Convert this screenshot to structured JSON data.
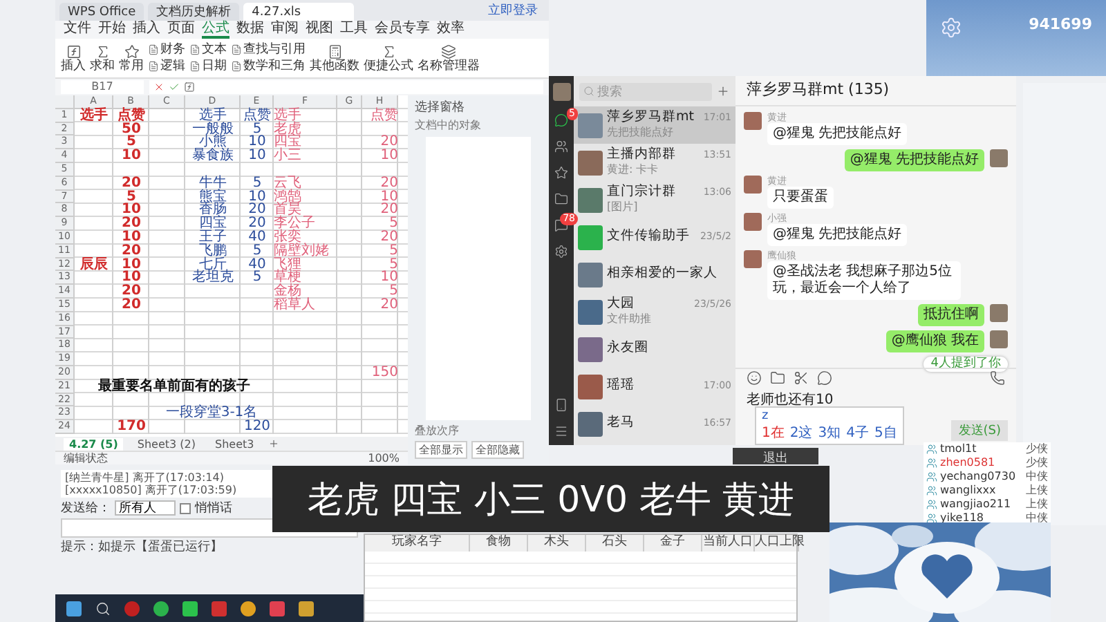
{
  "wps": {
    "tabs": [
      {
        "label": "WPS Office",
        "selected": false
      },
      {
        "label": "文档历史解析",
        "selected": false
      },
      {
        "label": "4.27.xls",
        "selected": true
      }
    ],
    "login": "立即登录",
    "menu": [
      {
        "label": "文件",
        "selected": false
      },
      {
        "label": "开始",
        "selected": false
      },
      {
        "label": "插入",
        "selected": false
      },
      {
        "label": "页面",
        "selected": false
      },
      {
        "label": "公式",
        "selected": true
      },
      {
        "label": "数据",
        "selected": false
      },
      {
        "label": "审阅",
        "selected": false
      },
      {
        "label": "视图",
        "selected": false
      },
      {
        "label": "工具",
        "selected": false
      },
      {
        "label": "会员专享",
        "selected": false
      },
      {
        "label": "效率",
        "selected": false
      }
    ],
    "ribbon_big": [
      "插入",
      "求和",
      "常用"
    ],
    "ribbon_small": [
      [
        "财务",
        "逻辑"
      ],
      [
        "文本",
        "日期"
      ],
      [
        "查找与引用",
        "数学和三角"
      ]
    ],
    "ribbon_more": [
      "其他函数",
      "便捷公式",
      "名称管理器"
    ],
    "name_box": "B17",
    "columns": [
      "A",
      "B",
      "C",
      "D",
      "E",
      "F",
      "G",
      "H"
    ],
    "rows": [
      {
        "number": "1",
        "kind": "data",
        "cells": [
          "选手",
          "点赞",
          null,
          "选手",
          "点赞",
          "选手",
          null,
          "点赞"
        ]
      },
      {
        "number": "2",
        "kind": "data",
        "cells": [
          null,
          "50",
          null,
          "一般般",
          "5",
          "老虎",
          null,
          null
        ]
      },
      {
        "number": "3",
        "kind": "data",
        "cells": [
          null,
          "5",
          null,
          "小熊",
          "10",
          "四宝",
          null,
          "20"
        ]
      },
      {
        "number": "4",
        "kind": "data",
        "cells": [
          null,
          "10",
          null,
          "暴食族",
          "10",
          "小三",
          null,
          "10"
        ]
      },
      {
        "number": "5",
        "kind": "data",
        "cells": [
          null,
          null,
          null,
          null,
          null,
          null,
          null,
          null
        ]
      },
      {
        "number": "6",
        "kind": "data",
        "cells": [
          null,
          "20",
          null,
          "牛牛",
          "5",
          "云飞",
          null,
          "20"
        ]
      },
      {
        "number": "7",
        "kind": "data",
        "cells": [
          null,
          "5",
          null,
          "熊宝",
          "10",
          "鸿鹄",
          null,
          "10"
        ]
      },
      {
        "number": "8",
        "kind": "data",
        "cells": [
          null,
          "10",
          null,
          "香肠",
          "20",
          "首昊",
          null,
          "20"
        ]
      },
      {
        "number": "9",
        "kind": "data",
        "cells": [
          null,
          "20",
          null,
          "四宝",
          "20",
          "李公子",
          null,
          "5"
        ]
      },
      {
        "number": "10",
        "kind": "data",
        "cells": [
          null,
          "10",
          null,
          "王子",
          "40",
          "张奕",
          null,
          "20"
        ]
      },
      {
        "number": "11",
        "kind": "data",
        "cells": [
          null,
          "20",
          null,
          "飞鹏",
          "5",
          "隔壁刘姥",
          null,
          "5"
        ]
      },
      {
        "number": "12",
        "kind": "data",
        "cells": [
          "辰辰",
          "10",
          null,
          "七斤",
          "40",
          "飞狸",
          null,
          "5"
        ]
      },
      {
        "number": "13",
        "kind": "data",
        "cells": [
          null,
          "10",
          null,
          "老坦克",
          "5",
          "草梗",
          null,
          "10"
        ]
      },
      {
        "number": "14",
        "kind": "data",
        "cells": [
          null,
          "20",
          null,
          null,
          null,
          "金杨",
          null,
          "5"
        ]
      },
      {
        "number": "15",
        "kind": "data",
        "cells": [
          null,
          "20",
          null,
          null,
          null,
          "稻草人",
          null,
          "20"
        ]
      },
      {
        "number": "16",
        "kind": "data",
        "cells": [
          null,
          null,
          null,
          null,
          null,
          null,
          null,
          null
        ]
      },
      {
        "number": "17",
        "kind": "data",
        "cells": [
          null,
          null,
          null,
          null,
          null,
          null,
          null,
          null
        ]
      },
      {
        "number": "18",
        "kind": "data",
        "cells": [
          null,
          null,
          null,
          null,
          null,
          null,
          null,
          null
        ]
      },
      {
        "number": "19",
        "kind": "data",
        "cells": [
          null,
          null,
          null,
          null,
          null,
          null,
          null,
          null
        ]
      },
      {
        "number": "20",
        "kind": "data",
        "cells": [
          null,
          null,
          null,
          null,
          null,
          null,
          null,
          "150"
        ]
      },
      {
        "number": "21",
        "kind": "note",
        "text": "最重要名单前面有的孩子"
      },
      {
        "number": "22",
        "kind": "data",
        "cells": [
          null,
          null,
          null,
          null,
          null,
          null,
          null,
          null
        ]
      },
      {
        "number": "23",
        "kind": "subtotal",
        "text": "一段穿堂3-1名"
      },
      {
        "number": "24",
        "kind": "data",
        "cells": [
          null,
          "170",
          null,
          null,
          "120",
          null,
          null,
          null
        ]
      }
    ],
    "sheets": [
      {
        "label": "4.27 (5)",
        "selected": true
      },
      {
        "label": "Sheet3 (2)",
        "selected": false
      },
      {
        "label": "Sheet3",
        "selected": false
      }
    ],
    "status": "编辑状态",
    "zoom": "100%",
    "pane": {
      "title": "选择窗格",
      "subtitle": "文档中的对象",
      "order": "叠放次序",
      "buttons": [
        "全部显示",
        "全部隐藏"
      ]
    }
  },
  "wechat": {
    "search": {
      "placeholder": "搜索"
    },
    "badges": [
      "5",
      "78"
    ],
    "chats": [
      {
        "name": "萍乡罗马群mt",
        "time": "17:01",
        "preview": "先把技能点好",
        "selected": true
      },
      {
        "name": "主播内部群",
        "time": "13:51",
        "preview": "黄进: 卡卡",
        "selected": false
      },
      {
        "name": "直门宗计群",
        "time": "13:06",
        "preview": "[图片]",
        "selected": false
      },
      {
        "name": "文件传输助手",
        "time": "23/5/2",
        "selected": false
      },
      {
        "name": "相亲相爱的一家人",
        "selected": false
      },
      {
        "name": "大园",
        "time": "23/5/26",
        "preview": "文件助推",
        "selected": false
      },
      {
        "name": "永友圈",
        "selected": false
      },
      {
        "name": "瑶瑶",
        "time": "17:00",
        "selected": false
      },
      {
        "name": "老马",
        "time": "16:57",
        "selected": false
      }
    ],
    "title": "萍乡罗马群mt (135)",
    "messages": [
      {
        "kind": "received",
        "sender": "黄进",
        "text": "@猩鬼 先把技能点好"
      },
      {
        "kind": "sent",
        "text": "@猩鬼 先把技能点好"
      },
      {
        "kind": "received",
        "sender": "黄进",
        "text": "只要蛋蛋"
      },
      {
        "kind": "received",
        "sender": "小强",
        "text": "@猩鬼 先把技能点好"
      },
      {
        "kind": "received",
        "sender": "鹰仙狼",
        "text": "@圣战法老 我想麻子那边5位玩，最近会一个人给了"
      },
      {
        "kind": "sent",
        "text": "抵抗住啊"
      },
      {
        "kind": "sent",
        "text": "@鹰仙狼 我在"
      }
    ],
    "toast": "4人提到了你",
    "input": "老师也还有10",
    "ime": {
      "typed": "z",
      "candidates": [
        {
          "label": "1在",
          "selected": true
        },
        {
          "label": "2这",
          "selected": false
        },
        {
          "label": "3知",
          "selected": false
        },
        {
          "label": "4子",
          "selected": false
        },
        {
          "label": "5自",
          "selected": false
        }
      ]
    },
    "send": "发送(S)"
  },
  "corner_text": "941699",
  "room": {
    "users": [
      {
        "name": "tmol1t",
        "status": "少侠"
      },
      {
        "name": "zhen0581",
        "status": "少侠"
      },
      {
        "name": "yechang0730",
        "status": "中侠"
      },
      {
        "name": "wanglixxx",
        "status": "上侠"
      },
      {
        "name": "wangjiao211",
        "status": "上侠"
      },
      {
        "name": "yike118",
        "status": "中侠"
      }
    ],
    "log": [
      "[纳兰青牛星] 离开了(17:03:14)",
      "[xxxxx10850] 离开了(17:03:59)"
    ],
    "send_to": "发送给：",
    "recipient": "所有人",
    "whisper": {
      "label": "悄悄话",
      "checked": false
    },
    "tip": "提示：如提示【蛋蛋已运行】"
  },
  "obs": {
    "exit": "退出",
    "subtitle": "老虎 四宝 小三 0V0 老牛 黄进"
  },
  "game_table": {
    "columns": [
      "玩家名字",
      "食物",
      "木头",
      "石头",
      "金子",
      "当前人口",
      "人口上限"
    ]
  }
}
